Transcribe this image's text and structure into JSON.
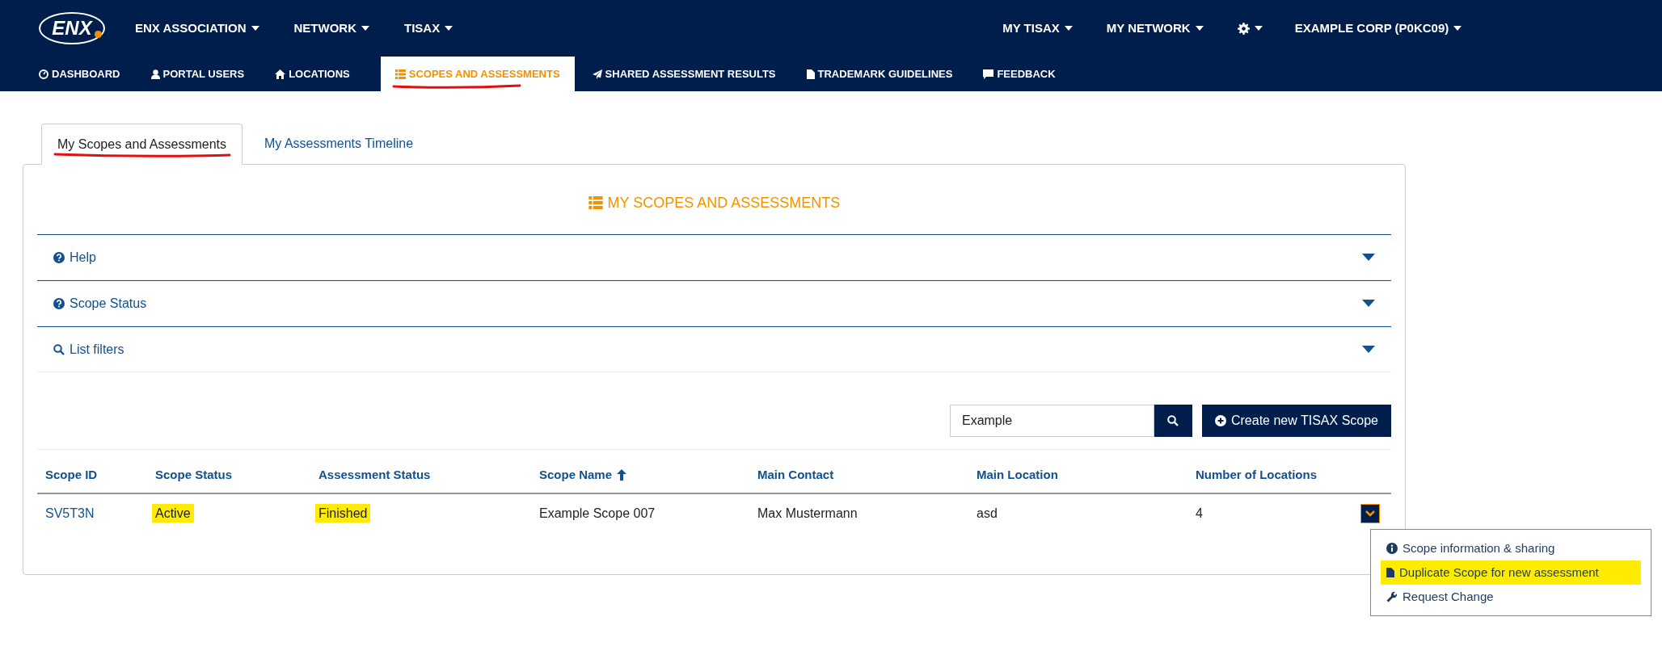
{
  "logo": {
    "text": "ENX"
  },
  "main_menu": [
    {
      "label": "ENX ASSOCIATION",
      "dropdown": true
    },
    {
      "label": "NETWORK",
      "dropdown": true
    },
    {
      "label": "TISAX",
      "dropdown": true
    }
  ],
  "user_menu": [
    {
      "kind": "text",
      "label": "MY TISAX"
    },
    {
      "kind": "text",
      "label": "MY NETWORK"
    },
    {
      "kind": "settings"
    },
    {
      "kind": "text",
      "label": "EXAMPLE CORP (P0KC09)"
    }
  ],
  "sub_nav": [
    {
      "label": "DASHBOARD",
      "kind": "dashboard",
      "selected": false,
      "annotated": false
    },
    {
      "label": "PORTAL USERS",
      "kind": "user",
      "selected": false,
      "annotated": false
    },
    {
      "label": "LOCATIONS",
      "kind": "home",
      "selected": false,
      "annotated": false
    },
    {
      "label": "SCOPES AND ASSESSMENTS",
      "kind": "list",
      "selected": true,
      "annotated": true
    },
    {
      "label": "SHARED ASSESSMENT RESULTS",
      "kind": "send",
      "selected": false,
      "annotated": false
    },
    {
      "label": "TRADEMARK GUIDELINES",
      "kind": "file",
      "selected": false,
      "annotated": false
    },
    {
      "label": "FEEDBACK",
      "kind": "comment",
      "selected": false,
      "annotated": false
    }
  ],
  "tabs": [
    {
      "label": "My Scopes and Assessments",
      "selected": true,
      "annotated": true
    },
    {
      "label": "My Assessments Timeline",
      "selected": false,
      "annotated": false
    }
  ],
  "panel": {
    "title": "MY SCOPES AND ASSESSMENTS",
    "sections": [
      {
        "label": "Help",
        "kind": "help",
        "expanded": false
      },
      {
        "label": "Scope Status",
        "kind": "help",
        "expanded": false
      },
      {
        "label": "List filters",
        "kind": "search",
        "expanded": false
      }
    ],
    "search": {
      "value": "Example"
    },
    "create_button": "Create new TISAX Scope",
    "table": {
      "columns": [
        {
          "label": "Scope ID",
          "sorted": false
        },
        {
          "label": "Scope Status",
          "sorted": false
        },
        {
          "label": "Assessment Status",
          "sorted": false
        },
        {
          "label": "Scope Name",
          "sorted": true
        },
        {
          "label": "Main Contact",
          "sorted": false
        },
        {
          "label": "Main Location",
          "sorted": false
        },
        {
          "label": "Number of Locations",
          "sorted": false
        }
      ],
      "rows": [
        {
          "cells": [
            {
              "text": "SV5T3N",
              "kind": "link",
              "highlighted": false
            },
            {
              "text": "Active",
              "kind": "text",
              "highlighted": true
            },
            {
              "text": "Finished",
              "kind": "text",
              "highlighted": true
            },
            {
              "text": "Example Scope 007",
              "kind": "text",
              "highlighted": false
            },
            {
              "text": "Max Mustermann",
              "kind": "text",
              "highlighted": false
            },
            {
              "text": "asd",
              "kind": "text",
              "highlighted": false
            },
            {
              "text": "4",
              "kind": "text",
              "highlighted": false
            }
          ],
          "menu_open": true,
          "menu": [
            {
              "label": "Scope information & sharing",
              "kind": "info",
              "highlighted": false
            },
            {
              "label": "Duplicate Scope for new assessment",
              "kind": "file",
              "highlighted": true
            },
            {
              "label": "Request Change",
              "kind": "wrench",
              "highlighted": false
            }
          ]
        }
      ]
    }
  }
}
